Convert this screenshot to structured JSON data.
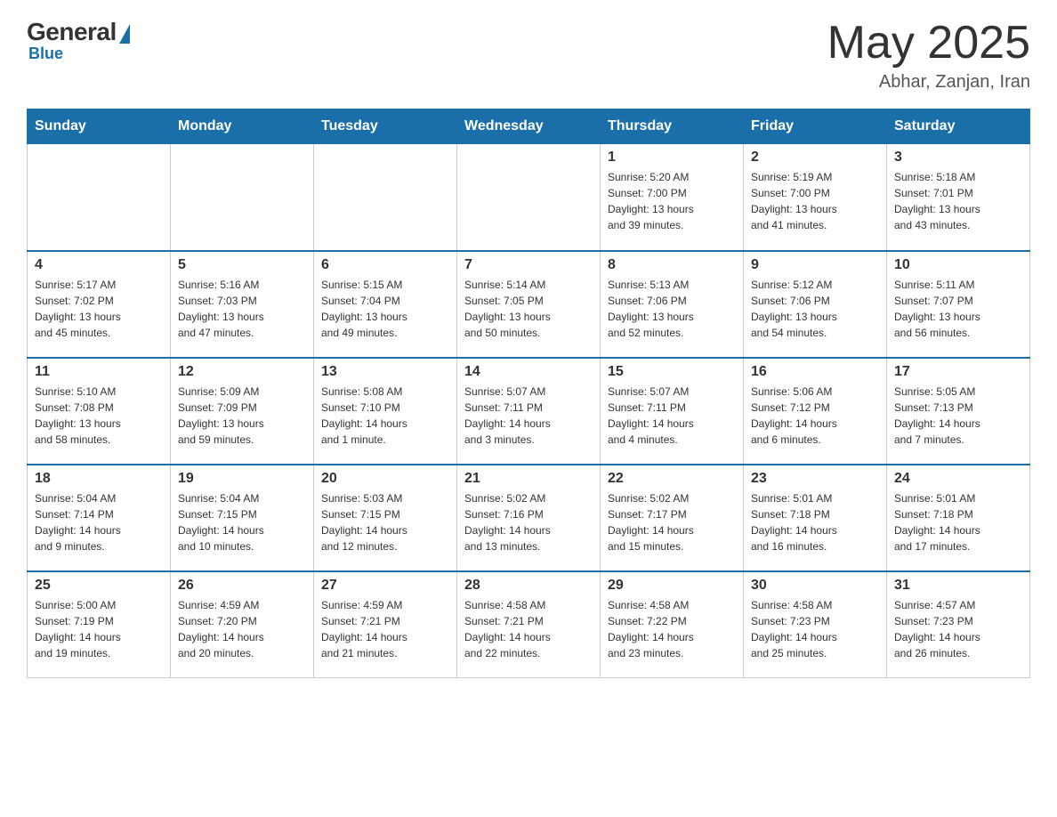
{
  "header": {
    "logo": {
      "general": "General",
      "blue": "Blue"
    },
    "title": "May 2025",
    "subtitle": "Abhar, Zanjan, Iran"
  },
  "calendar": {
    "days_of_week": [
      "Sunday",
      "Monday",
      "Tuesday",
      "Wednesday",
      "Thursday",
      "Friday",
      "Saturday"
    ],
    "weeks": [
      [
        {
          "day": "",
          "info": ""
        },
        {
          "day": "",
          "info": ""
        },
        {
          "day": "",
          "info": ""
        },
        {
          "day": "",
          "info": ""
        },
        {
          "day": "1",
          "info": "Sunrise: 5:20 AM\nSunset: 7:00 PM\nDaylight: 13 hours\nand 39 minutes."
        },
        {
          "day": "2",
          "info": "Sunrise: 5:19 AM\nSunset: 7:00 PM\nDaylight: 13 hours\nand 41 minutes."
        },
        {
          "day": "3",
          "info": "Sunrise: 5:18 AM\nSunset: 7:01 PM\nDaylight: 13 hours\nand 43 minutes."
        }
      ],
      [
        {
          "day": "4",
          "info": "Sunrise: 5:17 AM\nSunset: 7:02 PM\nDaylight: 13 hours\nand 45 minutes."
        },
        {
          "day": "5",
          "info": "Sunrise: 5:16 AM\nSunset: 7:03 PM\nDaylight: 13 hours\nand 47 minutes."
        },
        {
          "day": "6",
          "info": "Sunrise: 5:15 AM\nSunset: 7:04 PM\nDaylight: 13 hours\nand 49 minutes."
        },
        {
          "day": "7",
          "info": "Sunrise: 5:14 AM\nSunset: 7:05 PM\nDaylight: 13 hours\nand 50 minutes."
        },
        {
          "day": "8",
          "info": "Sunrise: 5:13 AM\nSunset: 7:06 PM\nDaylight: 13 hours\nand 52 minutes."
        },
        {
          "day": "9",
          "info": "Sunrise: 5:12 AM\nSunset: 7:06 PM\nDaylight: 13 hours\nand 54 minutes."
        },
        {
          "day": "10",
          "info": "Sunrise: 5:11 AM\nSunset: 7:07 PM\nDaylight: 13 hours\nand 56 minutes."
        }
      ],
      [
        {
          "day": "11",
          "info": "Sunrise: 5:10 AM\nSunset: 7:08 PM\nDaylight: 13 hours\nand 58 minutes."
        },
        {
          "day": "12",
          "info": "Sunrise: 5:09 AM\nSunset: 7:09 PM\nDaylight: 13 hours\nand 59 minutes."
        },
        {
          "day": "13",
          "info": "Sunrise: 5:08 AM\nSunset: 7:10 PM\nDaylight: 14 hours\nand 1 minute."
        },
        {
          "day": "14",
          "info": "Sunrise: 5:07 AM\nSunset: 7:11 PM\nDaylight: 14 hours\nand 3 minutes."
        },
        {
          "day": "15",
          "info": "Sunrise: 5:07 AM\nSunset: 7:11 PM\nDaylight: 14 hours\nand 4 minutes."
        },
        {
          "day": "16",
          "info": "Sunrise: 5:06 AM\nSunset: 7:12 PM\nDaylight: 14 hours\nand 6 minutes."
        },
        {
          "day": "17",
          "info": "Sunrise: 5:05 AM\nSunset: 7:13 PM\nDaylight: 14 hours\nand 7 minutes."
        }
      ],
      [
        {
          "day": "18",
          "info": "Sunrise: 5:04 AM\nSunset: 7:14 PM\nDaylight: 14 hours\nand 9 minutes."
        },
        {
          "day": "19",
          "info": "Sunrise: 5:04 AM\nSunset: 7:15 PM\nDaylight: 14 hours\nand 10 minutes."
        },
        {
          "day": "20",
          "info": "Sunrise: 5:03 AM\nSunset: 7:15 PM\nDaylight: 14 hours\nand 12 minutes."
        },
        {
          "day": "21",
          "info": "Sunrise: 5:02 AM\nSunset: 7:16 PM\nDaylight: 14 hours\nand 13 minutes."
        },
        {
          "day": "22",
          "info": "Sunrise: 5:02 AM\nSunset: 7:17 PM\nDaylight: 14 hours\nand 15 minutes."
        },
        {
          "day": "23",
          "info": "Sunrise: 5:01 AM\nSunset: 7:18 PM\nDaylight: 14 hours\nand 16 minutes."
        },
        {
          "day": "24",
          "info": "Sunrise: 5:01 AM\nSunset: 7:18 PM\nDaylight: 14 hours\nand 17 minutes."
        }
      ],
      [
        {
          "day": "25",
          "info": "Sunrise: 5:00 AM\nSunset: 7:19 PM\nDaylight: 14 hours\nand 19 minutes."
        },
        {
          "day": "26",
          "info": "Sunrise: 4:59 AM\nSunset: 7:20 PM\nDaylight: 14 hours\nand 20 minutes."
        },
        {
          "day": "27",
          "info": "Sunrise: 4:59 AM\nSunset: 7:21 PM\nDaylight: 14 hours\nand 21 minutes."
        },
        {
          "day": "28",
          "info": "Sunrise: 4:58 AM\nSunset: 7:21 PM\nDaylight: 14 hours\nand 22 minutes."
        },
        {
          "day": "29",
          "info": "Sunrise: 4:58 AM\nSunset: 7:22 PM\nDaylight: 14 hours\nand 23 minutes."
        },
        {
          "day": "30",
          "info": "Sunrise: 4:58 AM\nSunset: 7:23 PM\nDaylight: 14 hours\nand 25 minutes."
        },
        {
          "day": "31",
          "info": "Sunrise: 4:57 AM\nSunset: 7:23 PM\nDaylight: 14 hours\nand 26 minutes."
        }
      ]
    ]
  }
}
